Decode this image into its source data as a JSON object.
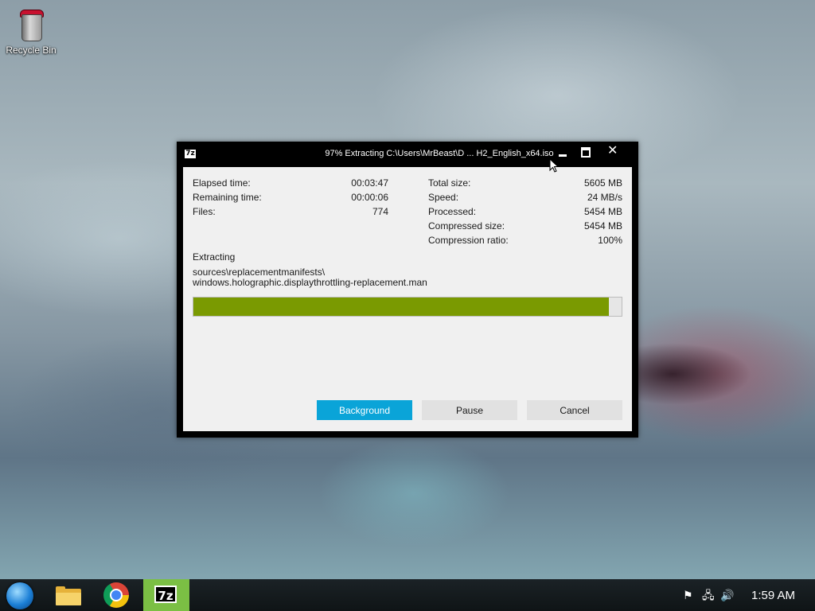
{
  "desktop": {
    "recycle_bin_label": "Recycle Bin"
  },
  "window": {
    "title": "97% Extracting C:\\Users\\MrBeast\\D ... H2_English_x64.iso",
    "app_icon_text": "7z",
    "controls": {
      "minimize_icon": "minimize-icon",
      "maximize_icon": "maximize-icon",
      "close_symbol": "✕"
    },
    "stats_left": [
      {
        "label": "Elapsed time:",
        "value": "00:03:47"
      },
      {
        "label": "Remaining time:",
        "value": "00:00:06"
      },
      {
        "label": "Files:",
        "value": "774"
      }
    ],
    "stats_right": [
      {
        "label": "Total size:",
        "value": "5605 MB"
      },
      {
        "label": "Speed:",
        "value": "24 MB/s"
      },
      {
        "label": "Processed:",
        "value": "5454 MB"
      },
      {
        "label": "Compressed size:",
        "value": "5454 MB"
      },
      {
        "label": "Compression ratio:",
        "value": "100%"
      }
    ],
    "status_label": "Extracting",
    "current_path_line1": "sources\\replacementmanifests\\",
    "current_path_line2": "windows.holographic.displaythrottling-replacement.man",
    "progress_fraction": 0.97,
    "progress_color": "#7a9a01",
    "buttons": {
      "background": "Background",
      "pause": "Pause",
      "cancel": "Cancel"
    },
    "accent_color": "#0aa4d8"
  },
  "taskbar": {
    "active_app_text": "7z",
    "active_app_color": "#7bbf44",
    "tray": {
      "flag_glyph": "⚑",
      "network_glyph": "🖧",
      "volume_glyph": "🔊"
    },
    "clock": "1:59 AM"
  }
}
